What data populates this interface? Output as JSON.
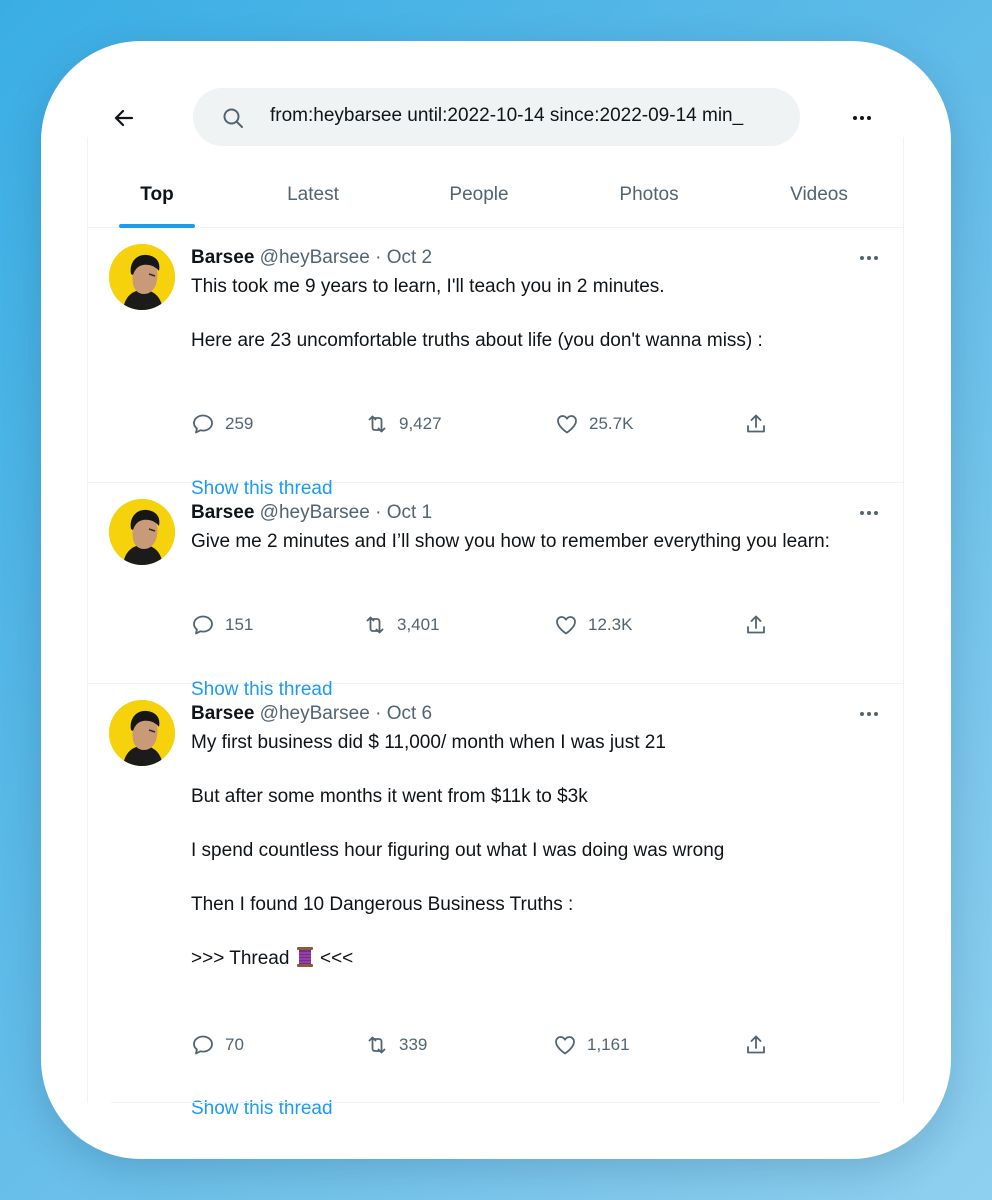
{
  "search": {
    "query": "from:heybarsee until:2022-10-14 since:2022-09-14 min_",
    "icon": "search-icon"
  },
  "header": {
    "back_icon": "arrow-left-icon",
    "more_icon": "more-horizontal-icon"
  },
  "tabs": [
    {
      "label": "Top",
      "active": true
    },
    {
      "label": "Latest",
      "active": false
    },
    {
      "label": "People",
      "active": false
    },
    {
      "label": "Photos",
      "active": false
    },
    {
      "label": "Videos",
      "active": false
    }
  ],
  "colors": {
    "accent": "#1d9bf0",
    "avatar_bg": "#f6d20c",
    "text": "#0f1419",
    "muted": "#536471"
  },
  "tweets": [
    {
      "name": "Barsee",
      "handle": "@heyBarsee",
      "separator": "·",
      "date": "Oct 2",
      "lines": [
        "This took me 9 years to learn, I'll teach you in 2 minutes.",
        "",
        "Here are 23 uncomfortable truths about life (you don't wanna miss) :"
      ],
      "replies": "259",
      "retweets": "9,427",
      "likes": "25.7K",
      "show_thread": "Show this thread"
    },
    {
      "name": "Barsee",
      "handle": "@heyBarsee",
      "separator": "·",
      "date": "Oct 1",
      "lines": [
        "Give me 2 minutes and I’ll show you how to remember everything you learn:"
      ],
      "replies": "151",
      "retweets": "3,401",
      "likes": "12.3K",
      "show_thread": "Show this thread"
    },
    {
      "name": "Barsee",
      "handle": "@heyBarsee",
      "separator": "·",
      "date": "Oct 6",
      "lines": [
        "My first business did $ 11,000/ month when I was just 21",
        "",
        "But after some months it went from $11k to $3k",
        "",
        "I spend countless hour figuring out what I was doing was wrong",
        "",
        "Then I found 10 Dangerous Business Truths :",
        "",
        ">>> Thread 🧵 <<<"
      ],
      "thread_prefix": ">>> Thread ",
      "thread_suffix": " <<<",
      "replies": "70",
      "retweets": "339",
      "likes": "1,161",
      "show_thread": "Show this thread"
    }
  ]
}
